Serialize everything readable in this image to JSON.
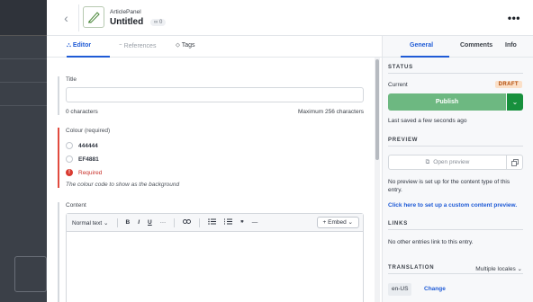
{
  "header": {
    "content_type": "ArticlePanel",
    "entry_title": "Untitled",
    "link_count": "0",
    "more_label": "•••"
  },
  "tabs": [
    {
      "label": "Editor",
      "icon": "editor-icon",
      "active": true
    },
    {
      "label": "References",
      "icon": "references-icon",
      "active": false
    },
    {
      "label": "Tags",
      "icon": "tag-icon",
      "active": false
    }
  ],
  "fields": {
    "title": {
      "label": "Title",
      "value": "",
      "char_count": "0 characters",
      "max_chars": "Maximum 256 characters"
    },
    "colour": {
      "label": "Colour (required)",
      "options": [
        "444444",
        "EF4881"
      ],
      "error": "Required",
      "help": "The colour code to show as the background"
    },
    "content": {
      "label": "Content",
      "toolbar": {
        "format": "Normal text",
        "bold": "B",
        "italic": "I",
        "underline": "U",
        "more": "···",
        "quote": "❞",
        "hr": "—",
        "embed": "+ Embed"
      }
    }
  },
  "sidebar": {
    "tabs": [
      "General",
      "Comments",
      "Info"
    ],
    "status": {
      "heading": "STATUS",
      "current_label": "Current",
      "badge": "DRAFT",
      "publish_label": "Publish",
      "last_saved": "Last saved a few seconds ago"
    },
    "preview": {
      "heading": "PREVIEW",
      "button_label": "Open preview",
      "note": "No preview is set up for the content type of this entry.",
      "link": "Click here to set up a custom content preview."
    },
    "links": {
      "heading": "LINKS",
      "note": "No other entries link to this entry."
    },
    "translation": {
      "heading": "TRANSLATION",
      "mode": "Multiple locales",
      "locale": "en-US",
      "change_label": "Change"
    }
  },
  "colors": {
    "accent": "#1f5bd6",
    "publish": "#6db881",
    "publish_dark": "#17903d",
    "error": "#d93a30",
    "draft_bg": "#fbe0c8"
  }
}
